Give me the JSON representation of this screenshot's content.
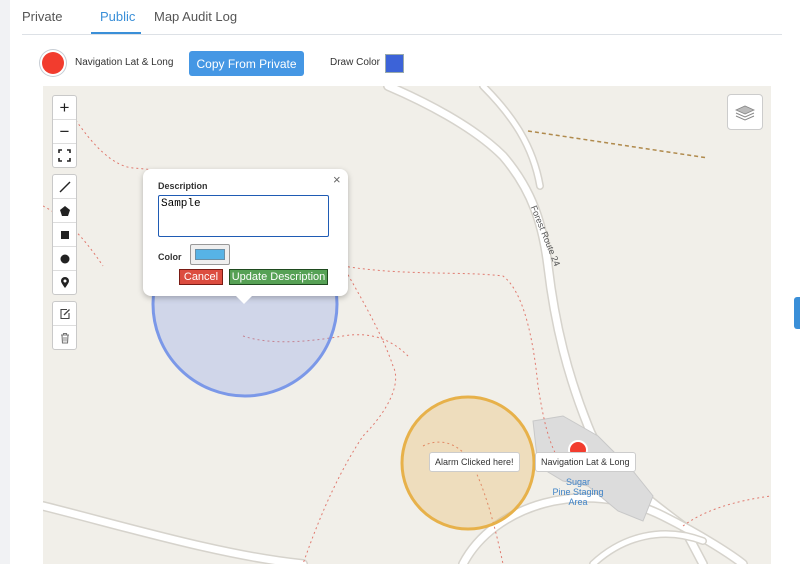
{
  "tabs": [
    {
      "label": "Private"
    },
    {
      "label": "Public"
    },
    {
      "label": "Map Audit Log"
    }
  ],
  "active_tab": "Public",
  "toolbar": {
    "nav_label": "Navigation Lat & Long",
    "copy_button": "Copy From Private",
    "draw_color_label": "Draw Color",
    "draw_color": "#3c63d8",
    "marker_color": "#f23c2e"
  },
  "map": {
    "zoom_controls": {
      "zoom_in": "+",
      "zoom_out": "−"
    },
    "draw_tools": [
      "polyline-icon",
      "polygon-icon",
      "rectangle-icon",
      "circle-icon",
      "marker-icon"
    ],
    "edit_tools": [
      "edit-icon",
      "trash-icon"
    ],
    "road_label": "Forest Route 24",
    "poi_label": [
      "Sugar",
      "Pine Staging",
      "Area"
    ],
    "alarm_tooltip": "Alarm Clicked here!",
    "nav_tooltip": "Navigation Lat & Long",
    "colors": {
      "blue_circle": "#7b98e8",
      "orange_circle": "#e7b14a",
      "trail": "#e07a6f"
    }
  },
  "popup": {
    "close": "×",
    "description_label": "Description",
    "description_value": "Sample",
    "color_label": "Color",
    "color_value": "#57b3e6",
    "cancel": "Cancel",
    "update": "Update Description"
  }
}
